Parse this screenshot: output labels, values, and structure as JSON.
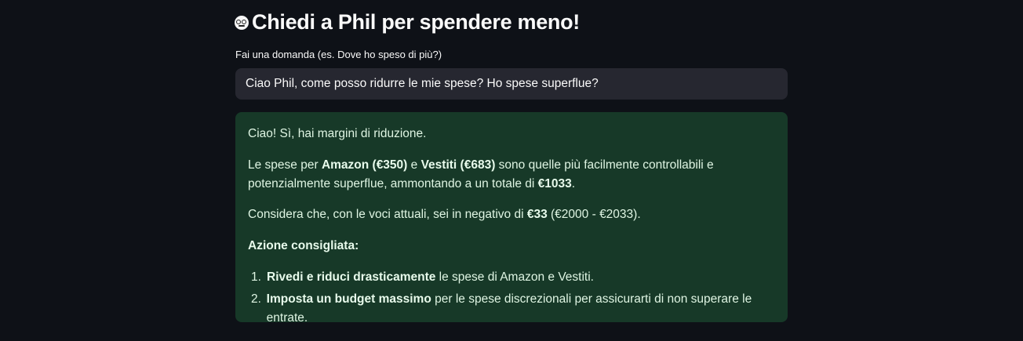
{
  "header": {
    "emoji_icon": "nerd-face-emoji-icon",
    "title": "Chiedi a Phil per spendere meno!"
  },
  "question": {
    "label": "Fai una domanda (es. Dove ho speso di più?)",
    "value": "Ciao Phil, come posso ridurre le mie spese? Ho spese superflue?"
  },
  "answer": {
    "colors": {
      "background": "#173928",
      "text": "#dff5e3"
    },
    "intro": "Ciao! Sì, hai margini di riduzione.",
    "p2": {
      "t1": "Le spese per ",
      "b1": "Amazon (€350)",
      "t2": " e ",
      "b2": "Vestiti (€683)",
      "t3": " sono quelle più facilmente controllabili e potenzialmente superflue, ammontando a un totale di ",
      "b3": "€1033",
      "t4": "."
    },
    "p3": {
      "t1": "Considera che, con le voci attuali, sei in negativo di ",
      "b1": "€33",
      "t2": " (€2000 - €2033)."
    },
    "action_heading": "Azione consigliata:",
    "items": [
      {
        "num": "1.",
        "bold": "Rivedi e riduci drasticamente",
        "text": " le spese di Amazon e Vestiti."
      },
      {
        "num": "2.",
        "bold": "Imposta un budget massimo",
        "text": " per le spese discrezionali per assicurarti di non superare le entrate."
      }
    ]
  }
}
